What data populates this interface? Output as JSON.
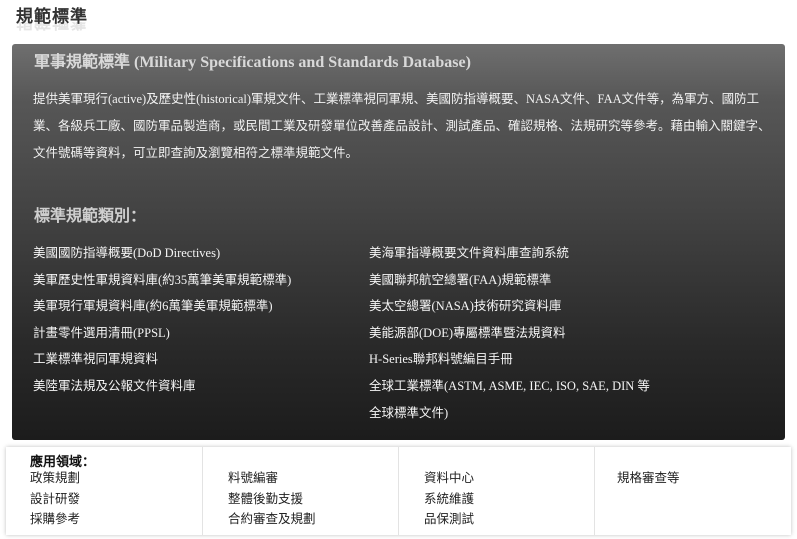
{
  "page": {
    "title": "規範標準"
  },
  "panel": {
    "heading": "軍事規範標準 (Military Specifications and Standards Database)",
    "description": "提供美軍現行(active)及歷史性(historical)軍規文件、工業標準視同軍規、美國防指導概要、NASA文件、FAA文件等，為軍方、國防工業、各級兵工廠、國防軍品製造商，或民間工業及研發單位改善產品設計、測試產品、確認規格、法規研究等參考。藉由輸入關鍵字、文件號碼等資料，可立即查詢及瀏覽相符之標準規範文件。"
  },
  "categories": {
    "heading": "標準規範類別：",
    "left": [
      "美國國防指導概要(DoD Directives)",
      "美軍歷史性軍規資料庫(約35萬筆美軍規範標準)",
      "美軍現行軍規資料庫(約6萬筆美軍規範標準)",
      "計畫零件選用清冊(PPSL)",
      "工業標準視同軍規資料",
      "美陸軍法規及公報文件資料庫"
    ],
    "right": [
      "美海軍指導概要文件資料庫查詢系統",
      "美國聯邦航空總署(FAA)規範標準",
      "美太空總署(NASA)技術研究資料庫",
      "美能源部(DOE)專屬標準暨法規資料",
      "H-Series聯邦料號編目手冊",
      "全球工業標準(ASTM, ASME, IEC, ISO, SAE, DIN 等全球標準文件)"
    ]
  },
  "applications": {
    "label": "應用領域：",
    "col1": [
      "政策規劃",
      "設計研發",
      "採購參考"
    ],
    "col2": [
      "料號編審",
      "整體後勤支援",
      "合約審查及規劃"
    ],
    "col3": [
      "資料中心",
      "系統維護",
      "品保測試"
    ],
    "col4": [
      "規格審查等"
    ]
  }
}
